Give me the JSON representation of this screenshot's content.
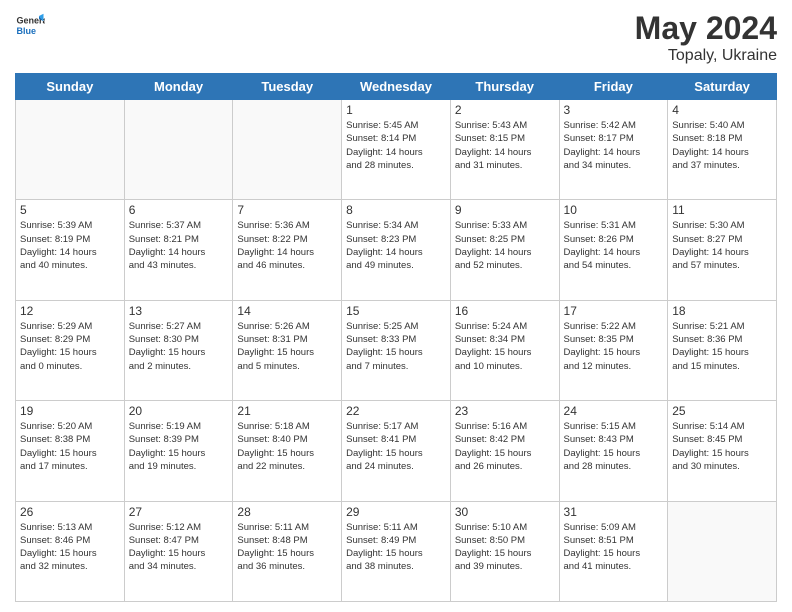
{
  "logo": {
    "general": "General",
    "blue": "Blue"
  },
  "title": "May 2024",
  "subtitle": "Topaly, Ukraine",
  "headers": [
    "Sunday",
    "Monday",
    "Tuesday",
    "Wednesday",
    "Thursday",
    "Friday",
    "Saturday"
  ],
  "weeks": [
    [
      {
        "day": "",
        "info": ""
      },
      {
        "day": "",
        "info": ""
      },
      {
        "day": "",
        "info": ""
      },
      {
        "day": "1",
        "info": "Sunrise: 5:45 AM\nSunset: 8:14 PM\nDaylight: 14 hours\nand 28 minutes."
      },
      {
        "day": "2",
        "info": "Sunrise: 5:43 AM\nSunset: 8:15 PM\nDaylight: 14 hours\nand 31 minutes."
      },
      {
        "day": "3",
        "info": "Sunrise: 5:42 AM\nSunset: 8:17 PM\nDaylight: 14 hours\nand 34 minutes."
      },
      {
        "day": "4",
        "info": "Sunrise: 5:40 AM\nSunset: 8:18 PM\nDaylight: 14 hours\nand 37 minutes."
      }
    ],
    [
      {
        "day": "5",
        "info": "Sunrise: 5:39 AM\nSunset: 8:19 PM\nDaylight: 14 hours\nand 40 minutes."
      },
      {
        "day": "6",
        "info": "Sunrise: 5:37 AM\nSunset: 8:21 PM\nDaylight: 14 hours\nand 43 minutes."
      },
      {
        "day": "7",
        "info": "Sunrise: 5:36 AM\nSunset: 8:22 PM\nDaylight: 14 hours\nand 46 minutes."
      },
      {
        "day": "8",
        "info": "Sunrise: 5:34 AM\nSunset: 8:23 PM\nDaylight: 14 hours\nand 49 minutes."
      },
      {
        "day": "9",
        "info": "Sunrise: 5:33 AM\nSunset: 8:25 PM\nDaylight: 14 hours\nand 52 minutes."
      },
      {
        "day": "10",
        "info": "Sunrise: 5:31 AM\nSunset: 8:26 PM\nDaylight: 14 hours\nand 54 minutes."
      },
      {
        "day": "11",
        "info": "Sunrise: 5:30 AM\nSunset: 8:27 PM\nDaylight: 14 hours\nand 57 minutes."
      }
    ],
    [
      {
        "day": "12",
        "info": "Sunrise: 5:29 AM\nSunset: 8:29 PM\nDaylight: 15 hours\nand 0 minutes."
      },
      {
        "day": "13",
        "info": "Sunrise: 5:27 AM\nSunset: 8:30 PM\nDaylight: 15 hours\nand 2 minutes."
      },
      {
        "day": "14",
        "info": "Sunrise: 5:26 AM\nSunset: 8:31 PM\nDaylight: 15 hours\nand 5 minutes."
      },
      {
        "day": "15",
        "info": "Sunrise: 5:25 AM\nSunset: 8:33 PM\nDaylight: 15 hours\nand 7 minutes."
      },
      {
        "day": "16",
        "info": "Sunrise: 5:24 AM\nSunset: 8:34 PM\nDaylight: 15 hours\nand 10 minutes."
      },
      {
        "day": "17",
        "info": "Sunrise: 5:22 AM\nSunset: 8:35 PM\nDaylight: 15 hours\nand 12 minutes."
      },
      {
        "day": "18",
        "info": "Sunrise: 5:21 AM\nSunset: 8:36 PM\nDaylight: 15 hours\nand 15 minutes."
      }
    ],
    [
      {
        "day": "19",
        "info": "Sunrise: 5:20 AM\nSunset: 8:38 PM\nDaylight: 15 hours\nand 17 minutes."
      },
      {
        "day": "20",
        "info": "Sunrise: 5:19 AM\nSunset: 8:39 PM\nDaylight: 15 hours\nand 19 minutes."
      },
      {
        "day": "21",
        "info": "Sunrise: 5:18 AM\nSunset: 8:40 PM\nDaylight: 15 hours\nand 22 minutes."
      },
      {
        "day": "22",
        "info": "Sunrise: 5:17 AM\nSunset: 8:41 PM\nDaylight: 15 hours\nand 24 minutes."
      },
      {
        "day": "23",
        "info": "Sunrise: 5:16 AM\nSunset: 8:42 PM\nDaylight: 15 hours\nand 26 minutes."
      },
      {
        "day": "24",
        "info": "Sunrise: 5:15 AM\nSunset: 8:43 PM\nDaylight: 15 hours\nand 28 minutes."
      },
      {
        "day": "25",
        "info": "Sunrise: 5:14 AM\nSunset: 8:45 PM\nDaylight: 15 hours\nand 30 minutes."
      }
    ],
    [
      {
        "day": "26",
        "info": "Sunrise: 5:13 AM\nSunset: 8:46 PM\nDaylight: 15 hours\nand 32 minutes."
      },
      {
        "day": "27",
        "info": "Sunrise: 5:12 AM\nSunset: 8:47 PM\nDaylight: 15 hours\nand 34 minutes."
      },
      {
        "day": "28",
        "info": "Sunrise: 5:11 AM\nSunset: 8:48 PM\nDaylight: 15 hours\nand 36 minutes."
      },
      {
        "day": "29",
        "info": "Sunrise: 5:11 AM\nSunset: 8:49 PM\nDaylight: 15 hours\nand 38 minutes."
      },
      {
        "day": "30",
        "info": "Sunrise: 5:10 AM\nSunset: 8:50 PM\nDaylight: 15 hours\nand 39 minutes."
      },
      {
        "day": "31",
        "info": "Sunrise: 5:09 AM\nSunset: 8:51 PM\nDaylight: 15 hours\nand 41 minutes."
      },
      {
        "day": "",
        "info": ""
      }
    ]
  ]
}
